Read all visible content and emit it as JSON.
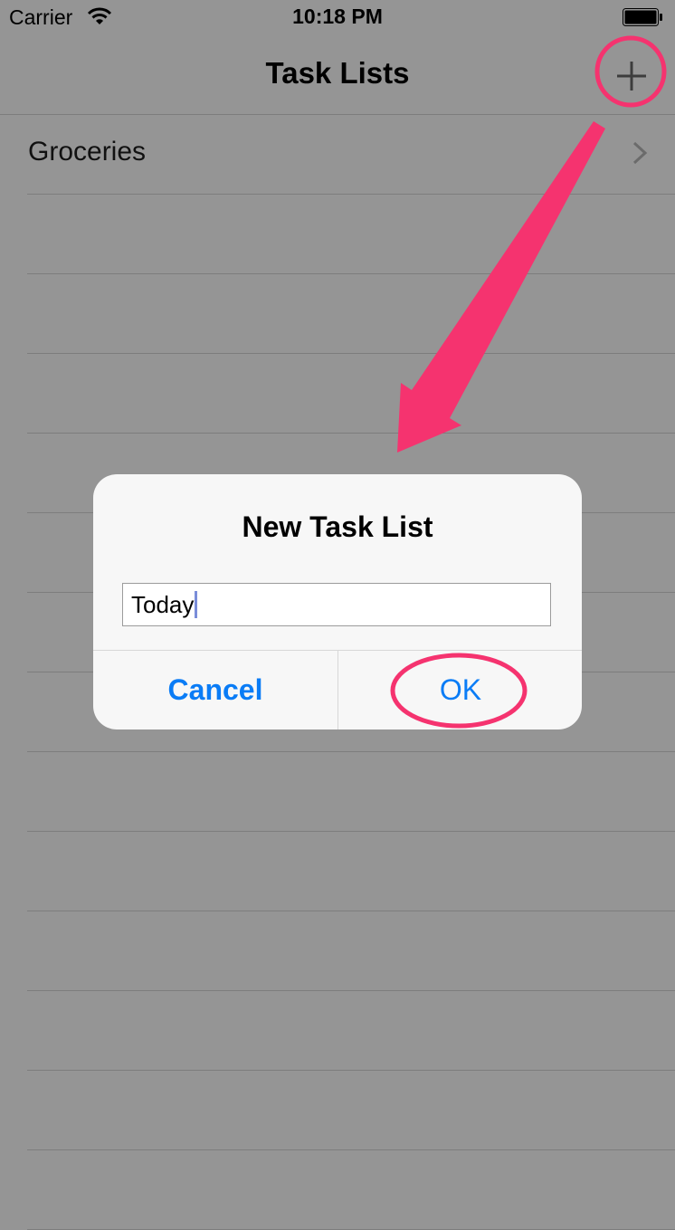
{
  "status_bar": {
    "carrier": "Carrier",
    "time": "10:18 PM"
  },
  "nav": {
    "title": "Task Lists",
    "add_icon": "plus-icon"
  },
  "lists": [
    {
      "label": "Groceries"
    }
  ],
  "alert": {
    "title": "New Task List",
    "input_value": "Today",
    "cancel_label": "Cancel",
    "ok_label": "OK"
  },
  "colors": {
    "dim_background": "#959595",
    "accent": "#0a7cf6",
    "annotation": "#f5336f"
  }
}
